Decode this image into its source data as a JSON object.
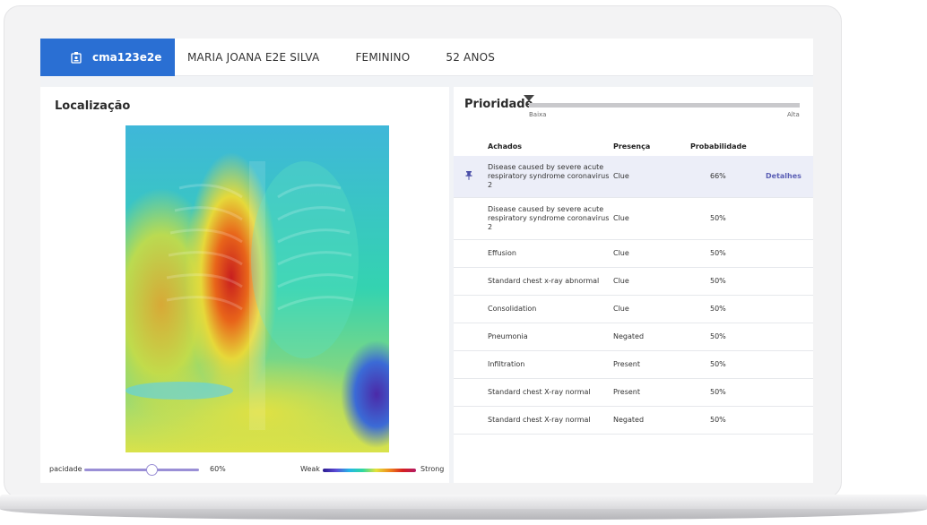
{
  "header": {
    "patient_id": "cma123e2e",
    "patient_name": "MARIA JOANA E2E SILVA",
    "sex": "FEMININO",
    "age": "52 ANOS"
  },
  "localizacao": {
    "title": "Localização",
    "opacity_label": "pacidade",
    "opacity_value": "60%",
    "opacity_level": 0.6,
    "weak_label": "Weak",
    "strong_label": "Strong"
  },
  "prioridade": {
    "title": "Prioridade",
    "low_label": "Baixa",
    "high_label": "Alta",
    "level": 0.0
  },
  "table": {
    "headers": {
      "findings": "Achados",
      "presence": "Presença",
      "probability": "Probabilidade"
    },
    "rows": [
      {
        "finding": "Disease caused by severe acute respiratory syndrome coronavirus 2",
        "presence": "Clue",
        "probability": "66%",
        "details": "Detalhes"
      },
      {
        "finding": "Disease caused by severe acute respiratory syndrome coronavirus 2",
        "presence": "Clue",
        "probability": "50%"
      },
      {
        "finding": "Effusion",
        "presence": "Clue",
        "probability": "50%"
      },
      {
        "finding": "Standard chest x-ray abnormal",
        "presence": "Clue",
        "probability": "50%"
      },
      {
        "finding": "Consolidation",
        "presence": "Clue",
        "probability": "50%"
      },
      {
        "finding": "Pneumonia",
        "presence": "Negated",
        "probability": "50%"
      },
      {
        "finding": "Infiltration",
        "presence": "Present",
        "probability": "50%"
      },
      {
        "finding": "Standard chest X-ray normal",
        "presence": "Present",
        "probability": "50%"
      },
      {
        "finding": "Standard chest X-ray normal",
        "presence": "Negated",
        "probability": "50%"
      }
    ]
  },
  "colors": {
    "accent": "#2a6fd3",
    "highlight_row": "#eceef8",
    "details_link": "#5b5fb5",
    "slider": "#9a8fd6"
  }
}
